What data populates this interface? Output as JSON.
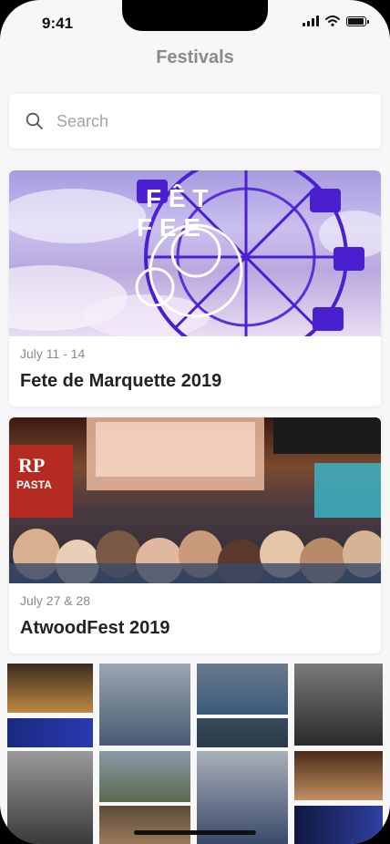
{
  "status": {
    "time": "9:41"
  },
  "header": {
    "title": "Festivals"
  },
  "search": {
    "placeholder": "Search"
  },
  "festivals": [
    {
      "date": "July 11 - 14",
      "name": "Fete de Marquette 2019",
      "image_text": "FÊTE FE E"
    },
    {
      "date": "July 27 & 28",
      "name": "AtwoodFest 2019",
      "image_text": "RP PASTA"
    }
  ],
  "colors": {
    "background": "#f7f7f8",
    "title": "#8a8a8e",
    "accent_purple": "#5b2fd6"
  }
}
